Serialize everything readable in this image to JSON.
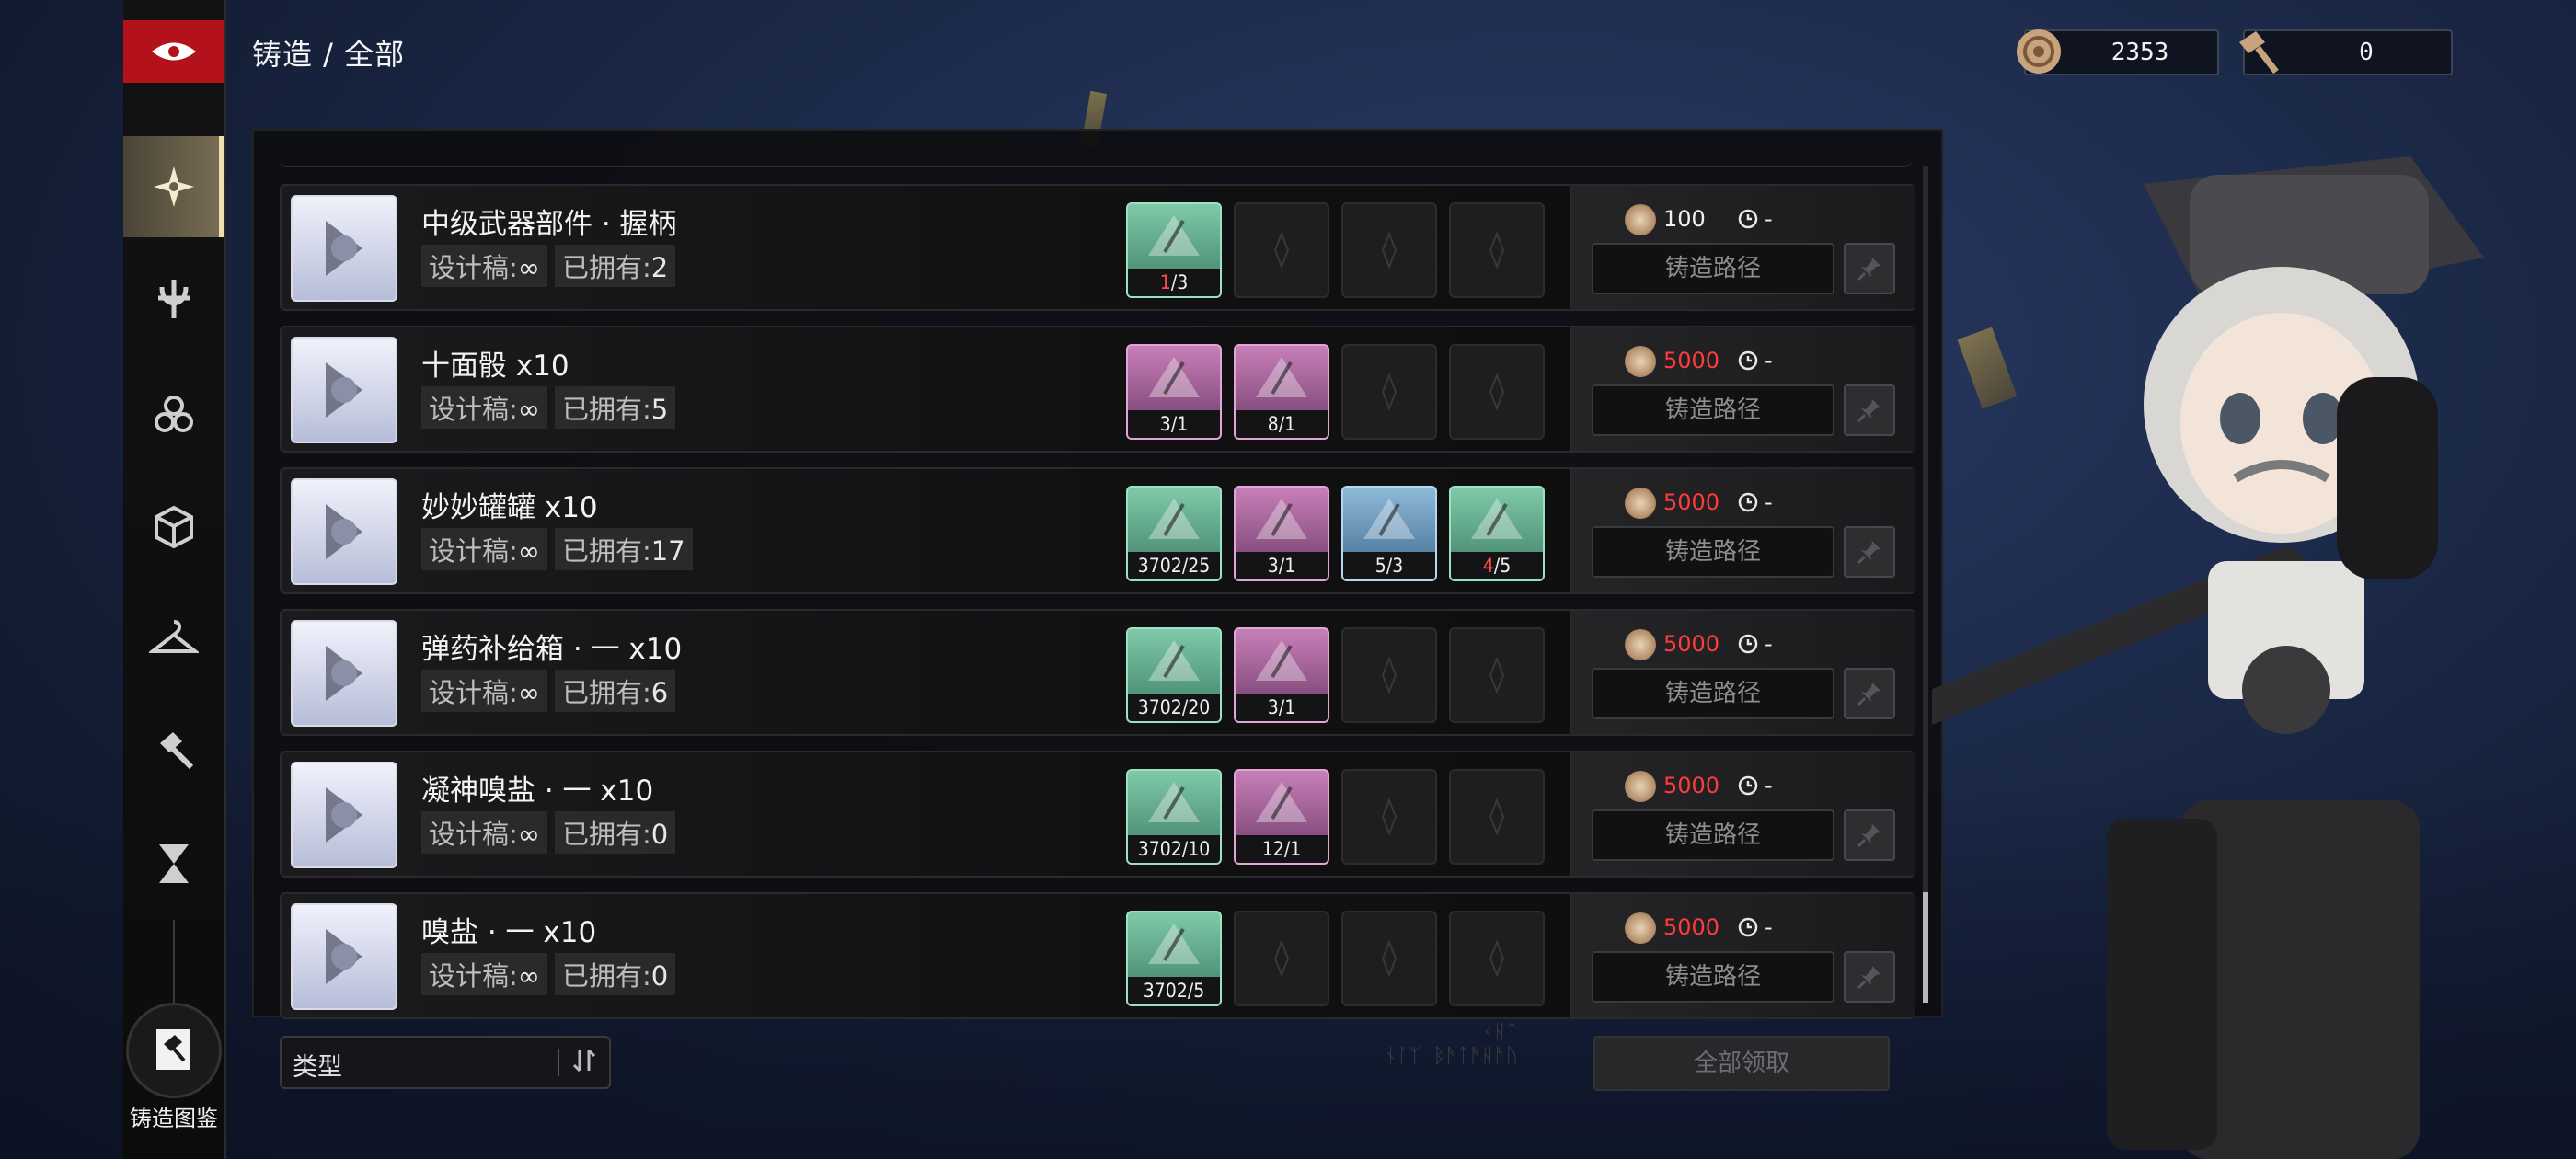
{
  "breadcrumb": "铸造 / 全部",
  "currency": [
    {
      "icon": "coin-icon",
      "value": "2353"
    },
    {
      "icon": "hammer-icon",
      "value": "0"
    }
  ],
  "sidebar": {
    "items": [
      {
        "icon": "shuriken-icon",
        "active": true
      },
      {
        "icon": "trident-icon"
      },
      {
        "icon": "triangle-knot-icon"
      },
      {
        "icon": "cube-icon"
      },
      {
        "icon": "hanger-icon"
      },
      {
        "icon": "hammer-icon"
      },
      {
        "icon": "hourglass-icon"
      }
    ],
    "codex_label": "铸造图鉴"
  },
  "labels": {
    "design": "设计稿:",
    "owned": "已拥有:",
    "route": "铸造路径",
    "timer": "-",
    "filter": "类型",
    "collect_all": "全部领取",
    "deco_line1": "ᚲᚺᛏ",
    "deco_line2": "ᚾᛚᛉ ᛒᚫᛏᚫᚺᚫᚢ"
  },
  "recipes": [
    {
      "name": "中级武器部件 · 握柄",
      "design": "∞",
      "owned": "2",
      "cost": "100",
      "cost_insufficient": false,
      "materials": [
        {
          "color": "green",
          "have": "1",
          "need": "3",
          "short": true
        }
      ]
    },
    {
      "name": "十面骰 x10",
      "design": "∞",
      "owned": "5",
      "cost": "5000",
      "cost_insufficient": true,
      "materials": [
        {
          "color": "pink",
          "have": "3",
          "need": "1",
          "short": false
        },
        {
          "color": "pink",
          "have": "8",
          "need": "1",
          "short": false
        }
      ]
    },
    {
      "name": "妙妙罐罐 x10",
      "design": "∞",
      "owned": "17",
      "cost": "5000",
      "cost_insufficient": true,
      "materials": [
        {
          "color": "green",
          "have": "3702",
          "need": "25",
          "short": false
        },
        {
          "color": "pink",
          "have": "3",
          "need": "1",
          "short": false
        },
        {
          "color": "blue",
          "have": "5",
          "need": "3",
          "short": false
        },
        {
          "color": "green",
          "have": "4",
          "need": "5",
          "short": true
        }
      ]
    },
    {
      "name": "弹药补给箱 · 一 x10",
      "design": "∞",
      "owned": "6",
      "cost": "5000",
      "cost_insufficient": true,
      "materials": [
        {
          "color": "green",
          "have": "3702",
          "need": "20",
          "short": false
        },
        {
          "color": "pink",
          "have": "3",
          "need": "1",
          "short": false
        }
      ]
    },
    {
      "name": "凝神嗅盐 · 一 x10",
      "design": "∞",
      "owned": "0",
      "cost": "5000",
      "cost_insufficient": true,
      "materials": [
        {
          "color": "green",
          "have": "3702",
          "need": "10",
          "short": false
        },
        {
          "color": "pink",
          "have": "12",
          "need": "1",
          "short": false
        }
      ]
    },
    {
      "name": "嗅盐 · 一 x10",
      "design": "∞",
      "owned": "0",
      "cost": "5000",
      "cost_insufficient": true,
      "materials": [
        {
          "color": "green",
          "have": "3702",
          "need": "5",
          "short": false
        }
      ]
    }
  ],
  "colors": {
    "accent_red": "#b3121b",
    "shortage": "#ff3b3b"
  }
}
